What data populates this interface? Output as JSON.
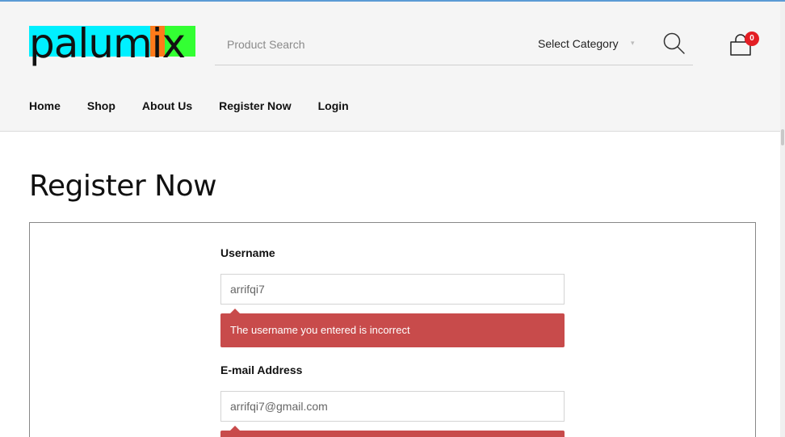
{
  "brand": {
    "logo_text": "palumix",
    "colors": {
      "cyan": "#00f0ff",
      "orange": "#ff7a1a",
      "green": "#33ff33"
    }
  },
  "search": {
    "placeholder": "Product Search",
    "category_label": "Select Category",
    "icon": "search-icon"
  },
  "cart": {
    "count": "0",
    "icon": "bag-icon"
  },
  "nav": {
    "items": [
      "Home",
      "Shop",
      "About Us",
      "Register Now",
      "Login"
    ]
  },
  "page": {
    "title": "Register Now"
  },
  "form": {
    "username": {
      "label": "Username",
      "value": "arrifqi7",
      "error": "The username you entered is incorrect"
    },
    "email": {
      "label": "E-mail Address",
      "value": "arrifqi7@gmail.com"
    }
  },
  "colors": {
    "error": "#c84b4b",
    "badge": "#e31e24"
  }
}
